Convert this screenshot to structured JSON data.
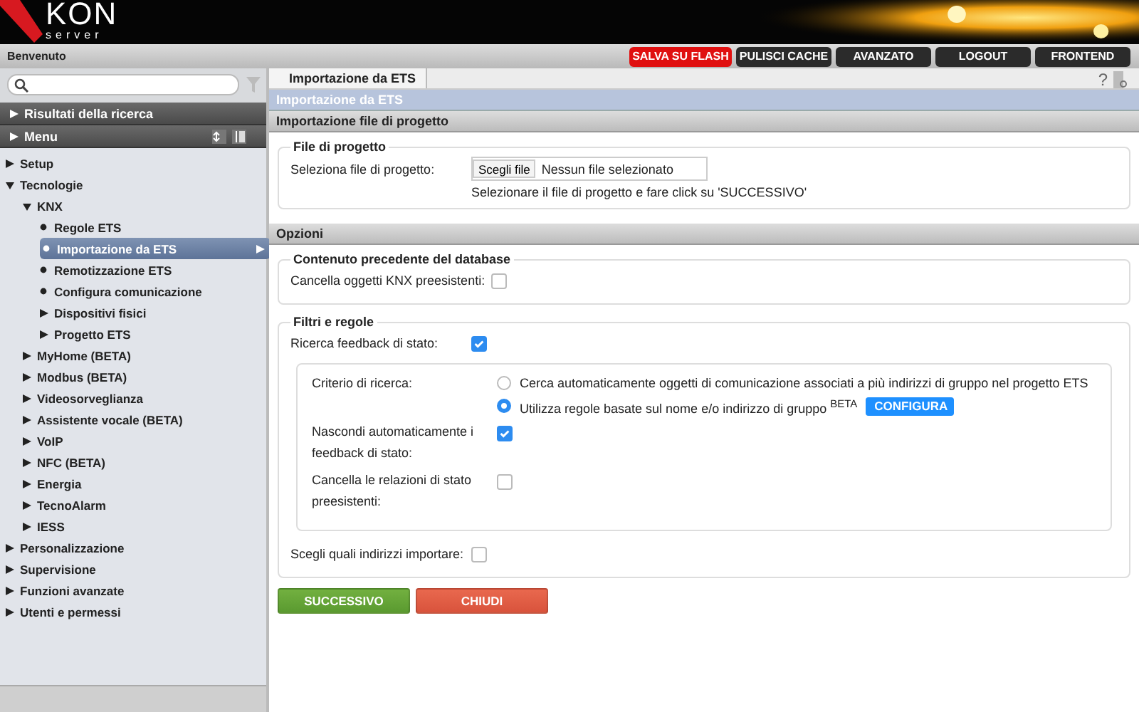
{
  "header": {
    "logo": {
      "brand": "KON",
      "sub": "server"
    },
    "welcome": "Benvenuto",
    "buttons": [
      {
        "label": "SALVA SU FLASH",
        "kind": "alert"
      },
      {
        "label": "PULISCI CACHE",
        "kind": "normal"
      },
      {
        "label": "AVANZATO",
        "kind": "normal"
      },
      {
        "label": "LOGOUT",
        "kind": "normal"
      },
      {
        "label": "FRONTEND",
        "kind": "normal"
      }
    ]
  },
  "sidebar": {
    "panels": [
      "Risultati della ricerca",
      "Menu"
    ],
    "tree": [
      {
        "label": "Setup",
        "kind": "folder",
        "expanded": false,
        "selected": false
      },
      {
        "label": "Tecnologie",
        "kind": "folder",
        "expanded": true,
        "selected": false,
        "children": [
          {
            "label": "KNX",
            "kind": "folder",
            "expanded": true,
            "selected": false,
            "children": [
              {
                "label": "Regole ETS",
                "kind": "leaf",
                "selected": false
              },
              {
                "label": "Importazione da ETS",
                "kind": "leaf",
                "selected": true
              },
              {
                "label": "Remotizzazione ETS",
                "kind": "leaf",
                "selected": false
              },
              {
                "label": "Configura comunicazione",
                "kind": "leaf",
                "selected": false
              },
              {
                "label": "Dispositivi fisici",
                "kind": "folder",
                "expanded": false,
                "selected": false
              },
              {
                "label": "Progetto ETS",
                "kind": "folder",
                "expanded": false,
                "selected": false
              }
            ]
          },
          {
            "label": "MyHome (BETA)",
            "kind": "folder",
            "expanded": false,
            "selected": false
          },
          {
            "label": "Modbus (BETA)",
            "kind": "folder",
            "expanded": false,
            "selected": false
          },
          {
            "label": "Videosorveglianza",
            "kind": "folder",
            "expanded": false,
            "selected": false
          },
          {
            "label": "Assistente vocale (BETA)",
            "kind": "folder",
            "expanded": false,
            "selected": false
          },
          {
            "label": "VoIP",
            "kind": "folder",
            "expanded": false,
            "selected": false
          },
          {
            "label": "NFC (BETA)",
            "kind": "folder",
            "expanded": false,
            "selected": false
          },
          {
            "label": "Energia",
            "kind": "folder",
            "expanded": false,
            "selected": false
          },
          {
            "label": "TecnoAlarm",
            "kind": "folder",
            "expanded": false,
            "selected": false
          },
          {
            "label": "IESS",
            "kind": "folder",
            "expanded": false,
            "selected": false
          }
        ]
      },
      {
        "label": "Personalizzazione",
        "kind": "folder",
        "expanded": false,
        "selected": false
      },
      {
        "label": "Supervisione",
        "kind": "folder",
        "expanded": false,
        "selected": false
      },
      {
        "label": "Funzioni avanzate",
        "kind": "folder",
        "expanded": false,
        "selected": false
      },
      {
        "label": "Utenti e permessi",
        "kind": "folder",
        "expanded": false,
        "selected": false
      }
    ]
  },
  "content": {
    "tabs": [
      {
        "label": "Importazione da ETS",
        "selected": true
      }
    ],
    "help": "?",
    "title": "Importazione da ETS",
    "file_section": {
      "heading": "Importazione file di progetto",
      "legend": "File di progetto",
      "label": "Seleziona file di progetto:",
      "choose_button": "Scegli file",
      "file_name": "Nessun file selezionato",
      "hint": "Selezionare il file di progetto e fare click su 'SUCCESSIVO'"
    },
    "options_heading": "Opzioni",
    "database": {
      "legend": "Contenuto precedente del database",
      "label": "Cancella oggetti KNX preesistenti:",
      "checked": false
    },
    "filters": {
      "legend": "Filtri e regole",
      "status_search": {
        "label": "Ricerca feedback di stato:",
        "checked": true
      },
      "criteria": {
        "label": "Criterio di ricerca:",
        "options": [
          {
            "label": "Cerca automaticamente oggetti di comunicazione associati a più indirizzi di gruppo nel progetto ETS",
            "selected": false
          },
          {
            "label": "Utilizza regole basate sul nome e/o indirizzo di gruppo $^{BETA}$",
            "selected": true,
            "button": "CONFIGURA"
          }
        ]
      },
      "sub_checks": [
        {
          "label": "Nascondi automaticamente i feedback di stato:",
          "checked": true
        },
        {
          "label": "Cancella le relazioni di stato preesistenti:",
          "checked": false
        }
      ],
      "import_choice": {
        "label": "Scegli quali indirizzi importare:",
        "checked": false
      }
    },
    "actions": [
      {
        "label": "SUCCESSIVO",
        "kind": "primary"
      },
      {
        "label": "CHIUDI",
        "kind": "danger"
      }
    ]
  }
}
